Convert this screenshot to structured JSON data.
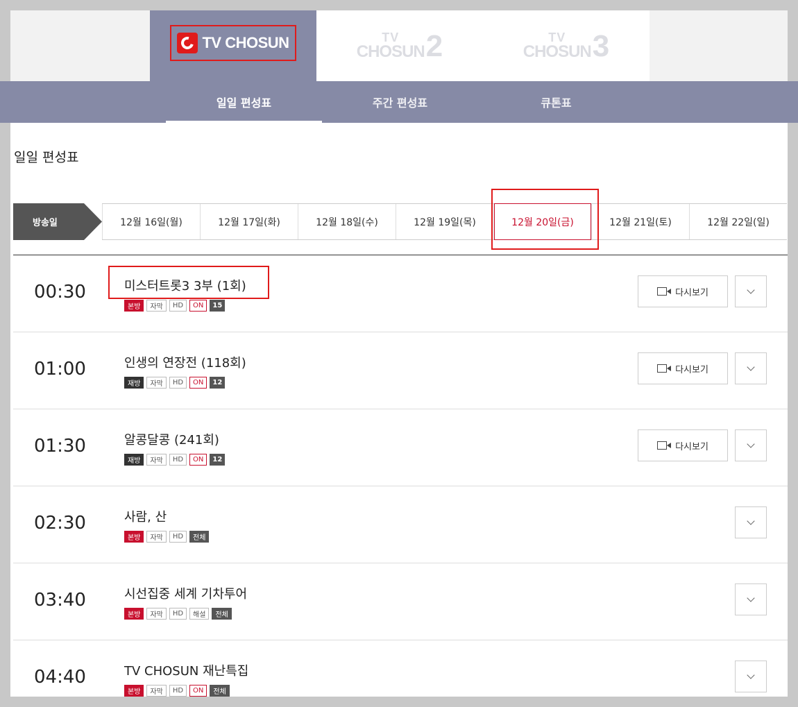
{
  "channels": [
    {
      "label": "TV CHOSUN",
      "active": true
    },
    {
      "label_top": "TV",
      "label_main": "CHOSUN",
      "number": "2"
    },
    {
      "label_top": "TV",
      "label_main": "CHOSUN",
      "number": "3"
    }
  ],
  "subnav": [
    "일일 편성표",
    "주간 편성표",
    "큐톤표"
  ],
  "section_title": "일일 편성표",
  "broadcast_label": "방송일",
  "dates": [
    "12월 16일(월)",
    "12월 17일(화)",
    "12월 18일(수)",
    "12월 19일(목)",
    "12월 20일(금)",
    "12월 21일(토)",
    "12월 22일(일)"
  ],
  "active_date_index": 4,
  "replay_label": "다시보기",
  "programs": [
    {
      "time": "00:30",
      "title": "미스터트롯3 3부 (1회)",
      "badges": [
        {
          "t": "본방",
          "k": "first"
        },
        {
          "t": "자막",
          "k": ""
        },
        {
          "t": "HD",
          "k": ""
        },
        {
          "t": "ON",
          "k": "on"
        },
        {
          "t": "15",
          "k": "age"
        }
      ],
      "replay": true
    },
    {
      "time": "01:00",
      "title": "인생의 연장전 (118회)",
      "badges": [
        {
          "t": "재방",
          "k": "rerun"
        },
        {
          "t": "자막",
          "k": ""
        },
        {
          "t": "HD",
          "k": ""
        },
        {
          "t": "ON",
          "k": "on"
        },
        {
          "t": "12",
          "k": "age"
        }
      ],
      "replay": true
    },
    {
      "time": "01:30",
      "title": "알콩달콩 (241회)",
      "badges": [
        {
          "t": "재방",
          "k": "rerun"
        },
        {
          "t": "자막",
          "k": ""
        },
        {
          "t": "HD",
          "k": ""
        },
        {
          "t": "ON",
          "k": "on"
        },
        {
          "t": "12",
          "k": "age"
        }
      ],
      "replay": true
    },
    {
      "time": "02:30",
      "title": "사람, 산",
      "badges": [
        {
          "t": "본방",
          "k": "first"
        },
        {
          "t": "자막",
          "k": ""
        },
        {
          "t": "HD",
          "k": ""
        },
        {
          "t": "전체",
          "k": "all"
        }
      ],
      "replay": false
    },
    {
      "time": "03:40",
      "title": "시선집중 세계 기차투어",
      "badges": [
        {
          "t": "본방",
          "k": "first"
        },
        {
          "t": "자막",
          "k": ""
        },
        {
          "t": "HD",
          "k": ""
        },
        {
          "t": "해설",
          "k": ""
        },
        {
          "t": "전체",
          "k": "all"
        }
      ],
      "replay": false
    },
    {
      "time": "04:40",
      "title": "TV CHOSUN 재난특집",
      "badges": [
        {
          "t": "본방",
          "k": "first"
        },
        {
          "t": "자막",
          "k": ""
        },
        {
          "t": "HD",
          "k": ""
        },
        {
          "t": "ON",
          "k": "on"
        },
        {
          "t": "전체",
          "k": "all"
        }
      ],
      "replay": false
    }
  ],
  "colors": {
    "accent_red": "#c8102e",
    "nav_bg": "#868aa6",
    "highlight_box": "#e01b1b"
  }
}
